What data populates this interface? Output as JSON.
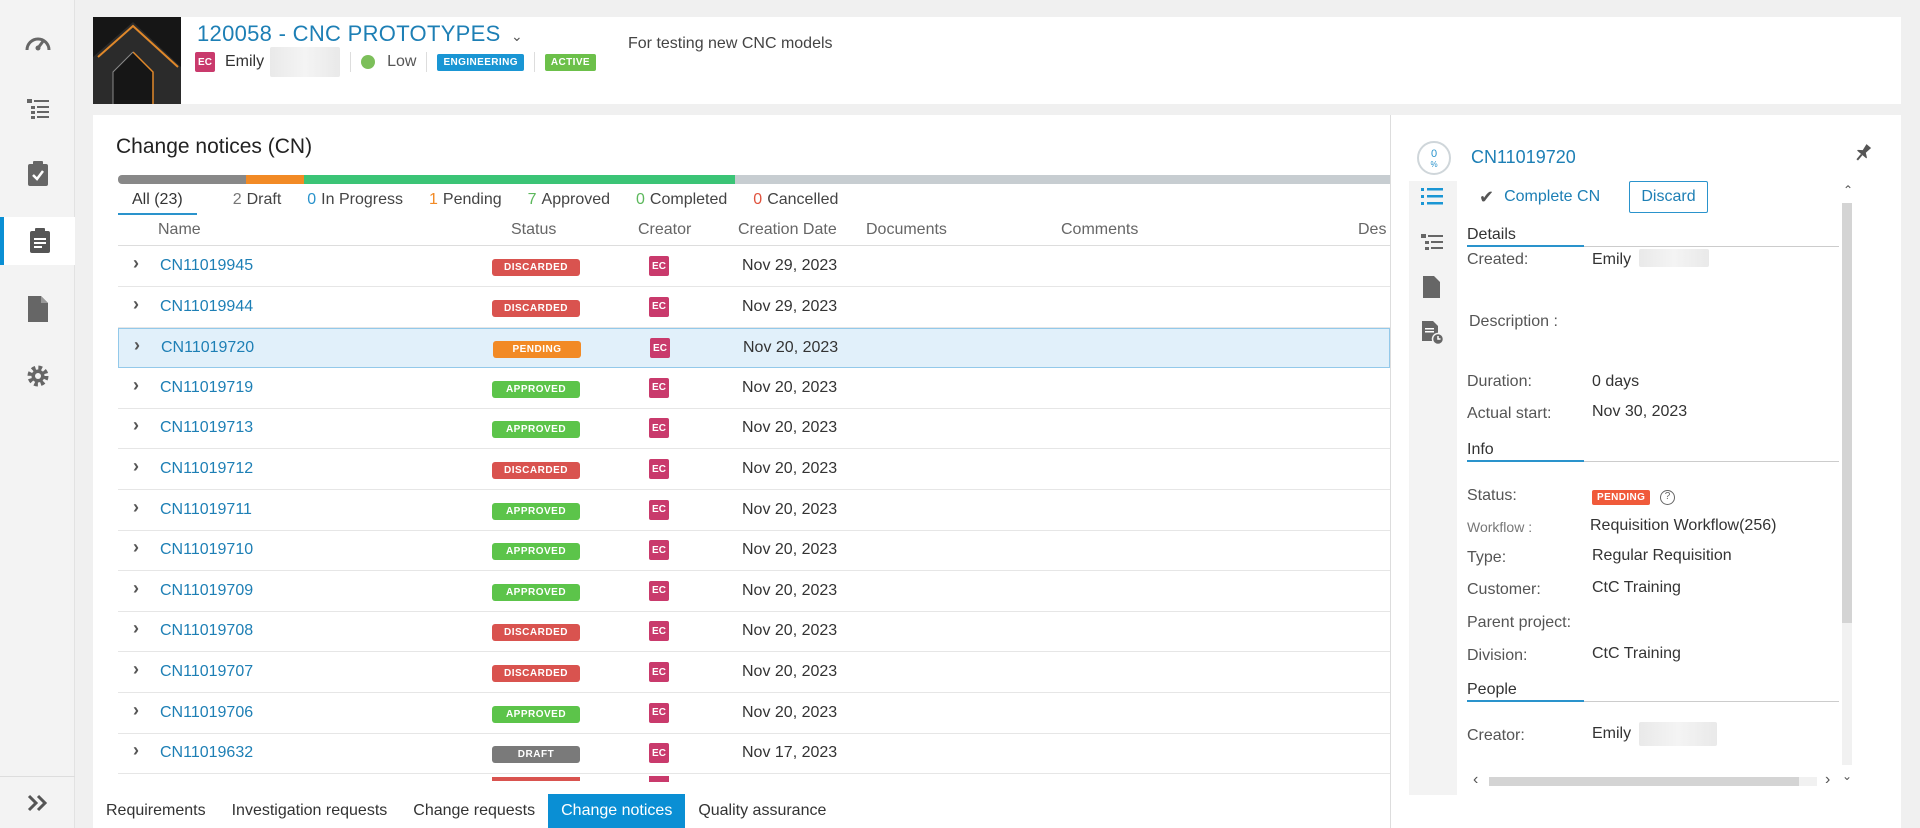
{
  "project": {
    "title": "120058 - CNC PROTOTYPES",
    "owner_initials": "EC",
    "owner_name": "Emily",
    "priority": "Low",
    "tag_department": "ENGINEERING",
    "tag_state": "ACTIVE",
    "description": "For testing new CNC models"
  },
  "page": {
    "title": "Change notices (CN)"
  },
  "progress": [
    {
      "fraction": 0.101,
      "color": "#888888"
    },
    {
      "fraction": 0.045,
      "color": "#f28a25"
    },
    {
      "fraction": 0.339,
      "color": "#3bc476"
    },
    {
      "fraction": 0.515,
      "color": "#c7cdd1"
    }
  ],
  "filters": [
    {
      "count": "All (23)",
      "label": "",
      "color": "#333333"
    },
    {
      "count": "2",
      "label": "Draft",
      "color": "#777777"
    },
    {
      "count": "0",
      "label": "In Progress",
      "color": "#2a93cc"
    },
    {
      "count": "1",
      "label": "Pending",
      "color": "#f28a25"
    },
    {
      "count": "7",
      "label": "Approved",
      "color": "#5cb85c"
    },
    {
      "count": "0",
      "label": "Completed",
      "color": "#5cb85c"
    },
    {
      "count": "0",
      "label": "Cancelled",
      "color": "#e0533e"
    }
  ],
  "columns": {
    "name": "Name",
    "status": "Status",
    "creator": "Creator",
    "creation_date": "Creation Date",
    "documents": "Documents",
    "comments": "Comments",
    "description": "Des"
  },
  "rows": [
    {
      "name": "CN11019945",
      "status": "DISCARDED",
      "creator": "EC",
      "date": "Nov 29, 2023"
    },
    {
      "name": "CN11019944",
      "status": "DISCARDED",
      "creator": "EC",
      "date": "Nov 29, 2023"
    },
    {
      "name": "CN11019720",
      "status": "PENDING",
      "creator": "EC",
      "date": "Nov 20, 2023"
    },
    {
      "name": "CN11019719",
      "status": "APPROVED",
      "creator": "EC",
      "date": "Nov 20, 2023"
    },
    {
      "name": "CN11019713",
      "status": "APPROVED",
      "creator": "EC",
      "date": "Nov 20, 2023"
    },
    {
      "name": "CN11019712",
      "status": "DISCARDED",
      "creator": "EC",
      "date": "Nov 20, 2023"
    },
    {
      "name": "CN11019711",
      "status": "APPROVED",
      "creator": "EC",
      "date": "Nov 20, 2023"
    },
    {
      "name": "CN11019710",
      "status": "APPROVED",
      "creator": "EC",
      "date": "Nov 20, 2023"
    },
    {
      "name": "CN11019709",
      "status": "APPROVED",
      "creator": "EC",
      "date": "Nov 20, 2023"
    },
    {
      "name": "CN11019708",
      "status": "DISCARDED",
      "creator": "EC",
      "date": "Nov 20, 2023"
    },
    {
      "name": "CN11019707",
      "status": "DISCARDED",
      "creator": "EC",
      "date": "Nov 20, 2023"
    },
    {
      "name": "CN11019706",
      "status": "APPROVED",
      "creator": "EC",
      "date": "Nov 20, 2023"
    },
    {
      "name": "CN11019632",
      "status": "DRAFT",
      "creator": "EC",
      "date": "Nov 17, 2023"
    }
  ],
  "status_colors": {
    "DISCARDED": "#d9534f",
    "PENDING": "#f28a25",
    "APPROVED": "#5cc44a",
    "DRAFT": "#7a7a7a"
  },
  "bottom_tabs": [
    {
      "label": "Requirements",
      "active": false
    },
    {
      "label": "Investigation requests",
      "active": false
    },
    {
      "label": "Change requests",
      "active": false
    },
    {
      "label": "Change notices",
      "active": true
    },
    {
      "label": "Quality assurance",
      "active": false
    }
  ],
  "panel": {
    "percent": "0",
    "percent_sign": "%",
    "id": "CN11019720",
    "complete_label": "Complete CN",
    "discard_label": "Discard",
    "details_title": "Details",
    "created_label": "Created:",
    "created_value": "Emily",
    "description_label": "Description :",
    "duration_label": "Duration:",
    "duration_value": "0 days",
    "actual_start_label": "Actual start:",
    "actual_start_value": "Nov 30, 2023",
    "info_title": "Info",
    "status_label": "Status:",
    "status_value": "PENDING",
    "workflow_label": "Workflow :",
    "workflow_value": "Requisition Workflow(256)",
    "type_label": "Type:",
    "type_value": "Regular Requisition",
    "customer_label": "Customer:",
    "customer_value": "CtC Training",
    "parent_label": "Parent project:",
    "division_label": "Division:",
    "division_value": "CtC Training",
    "people_title": "People",
    "creator_label": "Creator:",
    "creator_value": "Emily"
  }
}
